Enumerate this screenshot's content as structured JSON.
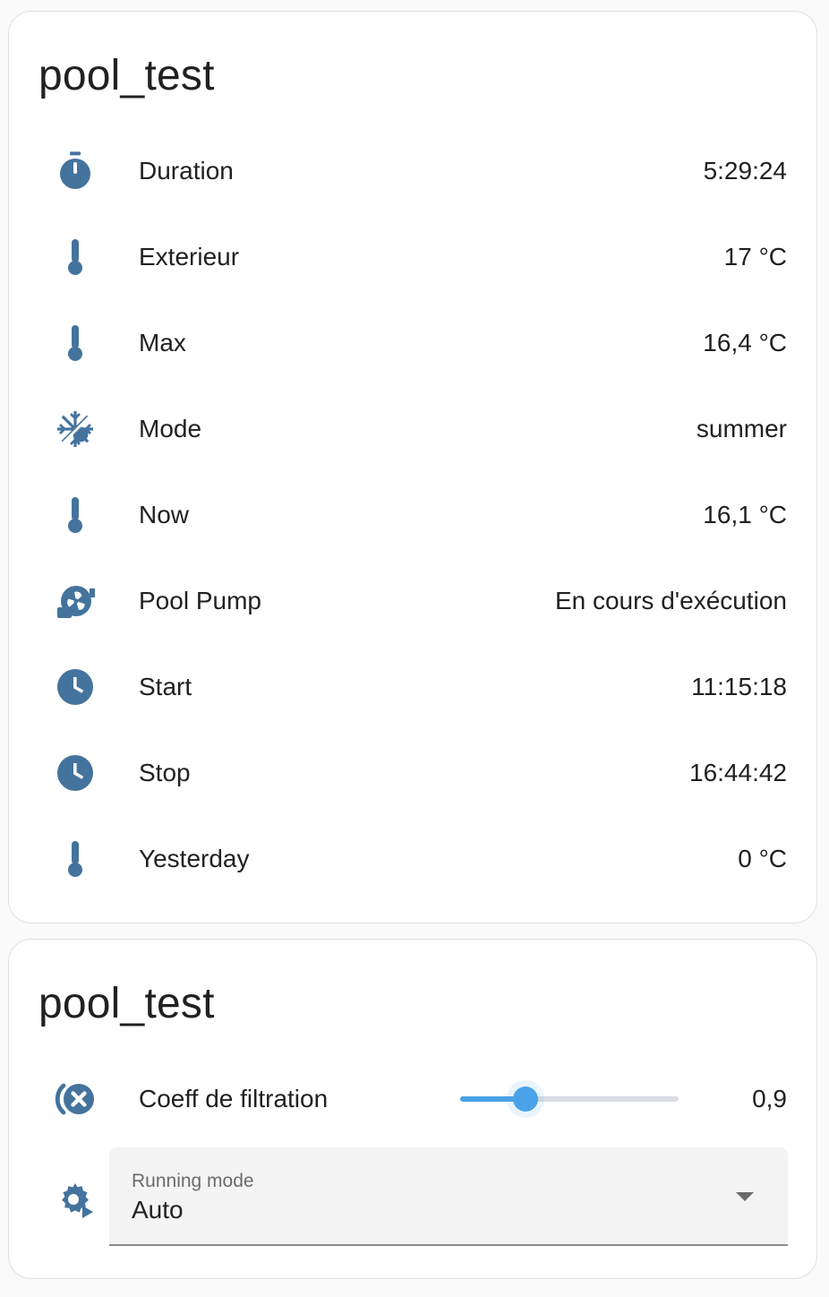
{
  "card_entities": {
    "title": "pool_test",
    "rows": [
      {
        "icon": "timer-icon",
        "name": "Duration",
        "value": "5:29:24"
      },
      {
        "icon": "thermometer-icon",
        "name": "Exterieur",
        "value": "17 °C"
      },
      {
        "icon": "thermometer-icon",
        "name": "Max",
        "value": "16,4 °C"
      },
      {
        "icon": "sun-snowflake-icon",
        "name": "Mode",
        "value": "summer"
      },
      {
        "icon": "thermometer-icon",
        "name": "Now",
        "value": "16,1 °C"
      },
      {
        "icon": "pump-icon",
        "name": "Pool Pump",
        "value": "En cours d'exécution"
      },
      {
        "icon": "clock-icon",
        "name": "Start",
        "value": "11:15:18"
      },
      {
        "icon": "clock-icon",
        "name": "Stop",
        "value": "16:44:42"
      },
      {
        "icon": "thermometer-icon",
        "name": "Yesterday",
        "value": "0 °C"
      }
    ]
  },
  "card_controls": {
    "title": "pool_test",
    "coeff": {
      "icon": "water-remove-icon",
      "name": "Coeff de filtration",
      "value": "0,9",
      "slider_fraction": 0.3
    },
    "running_mode": {
      "icon": "cog-play-icon",
      "label": "Running mode",
      "value": "Auto"
    }
  },
  "colors": {
    "icon": "#44739e",
    "slider_accent": "#4aa3e8"
  }
}
